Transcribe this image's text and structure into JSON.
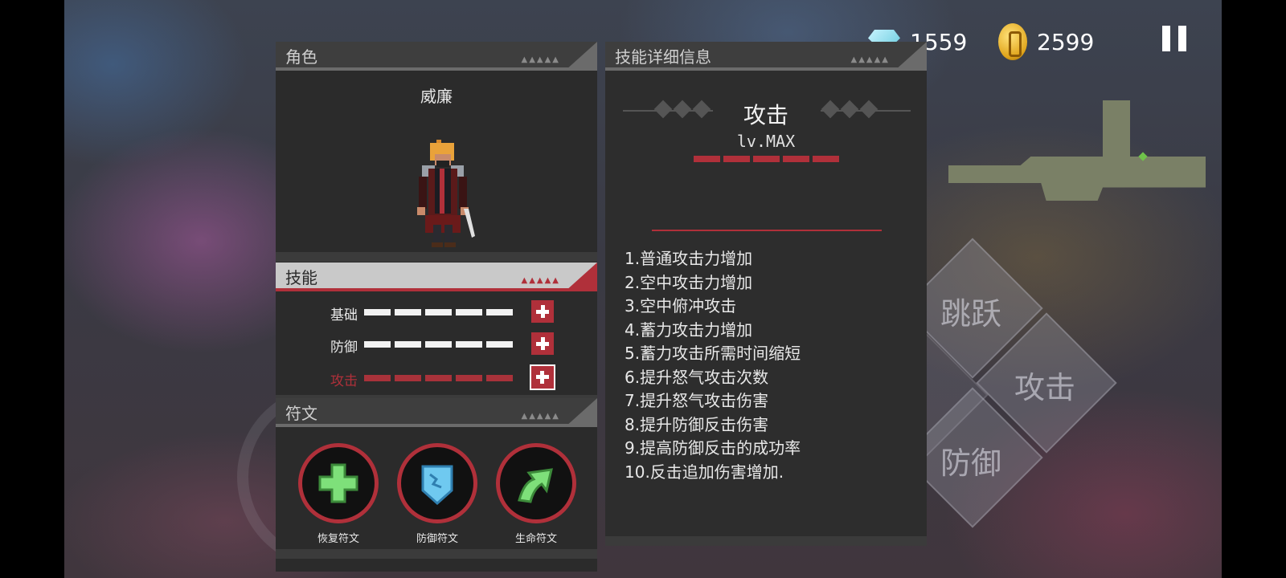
{
  "hud": {
    "gems": "1559",
    "coins": "2599",
    "gem_icon": "diamond-gem-icon",
    "coin_icon": "gold-coin-icon",
    "pause_icon": "pause-icon"
  },
  "controls": {
    "jump": "跳跃",
    "attack": "攻击",
    "defend": "防御"
  },
  "character_panel": {
    "header": "角色",
    "name": "威廉"
  },
  "skills_panel": {
    "header": "技能",
    "rows": [
      {
        "label": "基础",
        "level": 5,
        "max": 5,
        "selected": false
      },
      {
        "label": "防御",
        "level": 5,
        "max": 5,
        "selected": false
      },
      {
        "label": "攻击",
        "level": 5,
        "max": 5,
        "selected": true
      }
    ]
  },
  "runes_panel": {
    "header": "符文",
    "runes": [
      {
        "label": "恢复符文",
        "icon": "green-cross-icon"
      },
      {
        "label": "防御符文",
        "icon": "blue-shield-icon"
      },
      {
        "label": "生命符文",
        "icon": "green-arrow-up-icon"
      }
    ]
  },
  "detail_panel": {
    "header": "技能详细信息",
    "title": "攻击",
    "level": "lv.MAX",
    "level_value": 5,
    "items": [
      "1.普通攻击力增加",
      "2.空中攻击力增加",
      "3.空中俯冲攻击",
      "4.蓄力攻击力增加",
      "5.蓄力攻击所需时间缩短",
      "6.提升怒气攻击次数",
      "7.提升怒气攻击伤害",
      "8.提升防御反击伤害",
      "9.提高防御反击的成功率",
      "10.反击追加伤害增加."
    ]
  },
  "colors": {
    "accent": "#b0303a",
    "panel": "#2d2d2d",
    "header": "#3e3e3e"
  }
}
